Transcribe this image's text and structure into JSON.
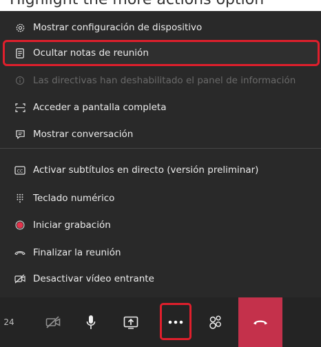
{
  "caption": "Highlight the more actions option",
  "menu": {
    "items": [
      {
        "label": "Mostrar configuración de dispositivo",
        "icon": "gear-icon",
        "state": "normal"
      },
      {
        "label": "Ocultar notas de reunión",
        "icon": "notes-icon",
        "state": "highlighted"
      },
      {
        "label": "Las directivas han deshabilitado el panel de información",
        "icon": "info-icon",
        "state": "disabled"
      },
      {
        "label": "Acceder a pantalla completa",
        "icon": "fullscreen-icon",
        "state": "normal"
      },
      {
        "label": "Mostrar conversación",
        "icon": "chat-icon",
        "state": "normal"
      },
      {
        "label": "Activar subtítulos en directo (versión preliminar)",
        "icon": "captions-icon",
        "state": "normal"
      },
      {
        "label": "Teclado numérico",
        "icon": "dialpad-icon",
        "state": "normal"
      },
      {
        "label": "Iniciar grabación",
        "icon": "record-icon",
        "state": "normal"
      },
      {
        "label": "Finalizar la reunión",
        "icon": "end-meeting-icon",
        "state": "normal"
      },
      {
        "label": "Desactivar vídeo entrante",
        "icon": "video-off-icon",
        "state": "normal"
      }
    ]
  },
  "toolbar": {
    "participant_count": "24",
    "buttons": [
      "camera-off-icon",
      "microphone-icon",
      "share-screen-icon",
      "more-actions-icon",
      "participants-icon",
      "hang-up-icon"
    ]
  },
  "colors": {
    "menu_bg": "#292929",
    "highlight_border": "#e01f2c",
    "hangup_bg": "#c4314b",
    "record_red": "#e3334b"
  }
}
